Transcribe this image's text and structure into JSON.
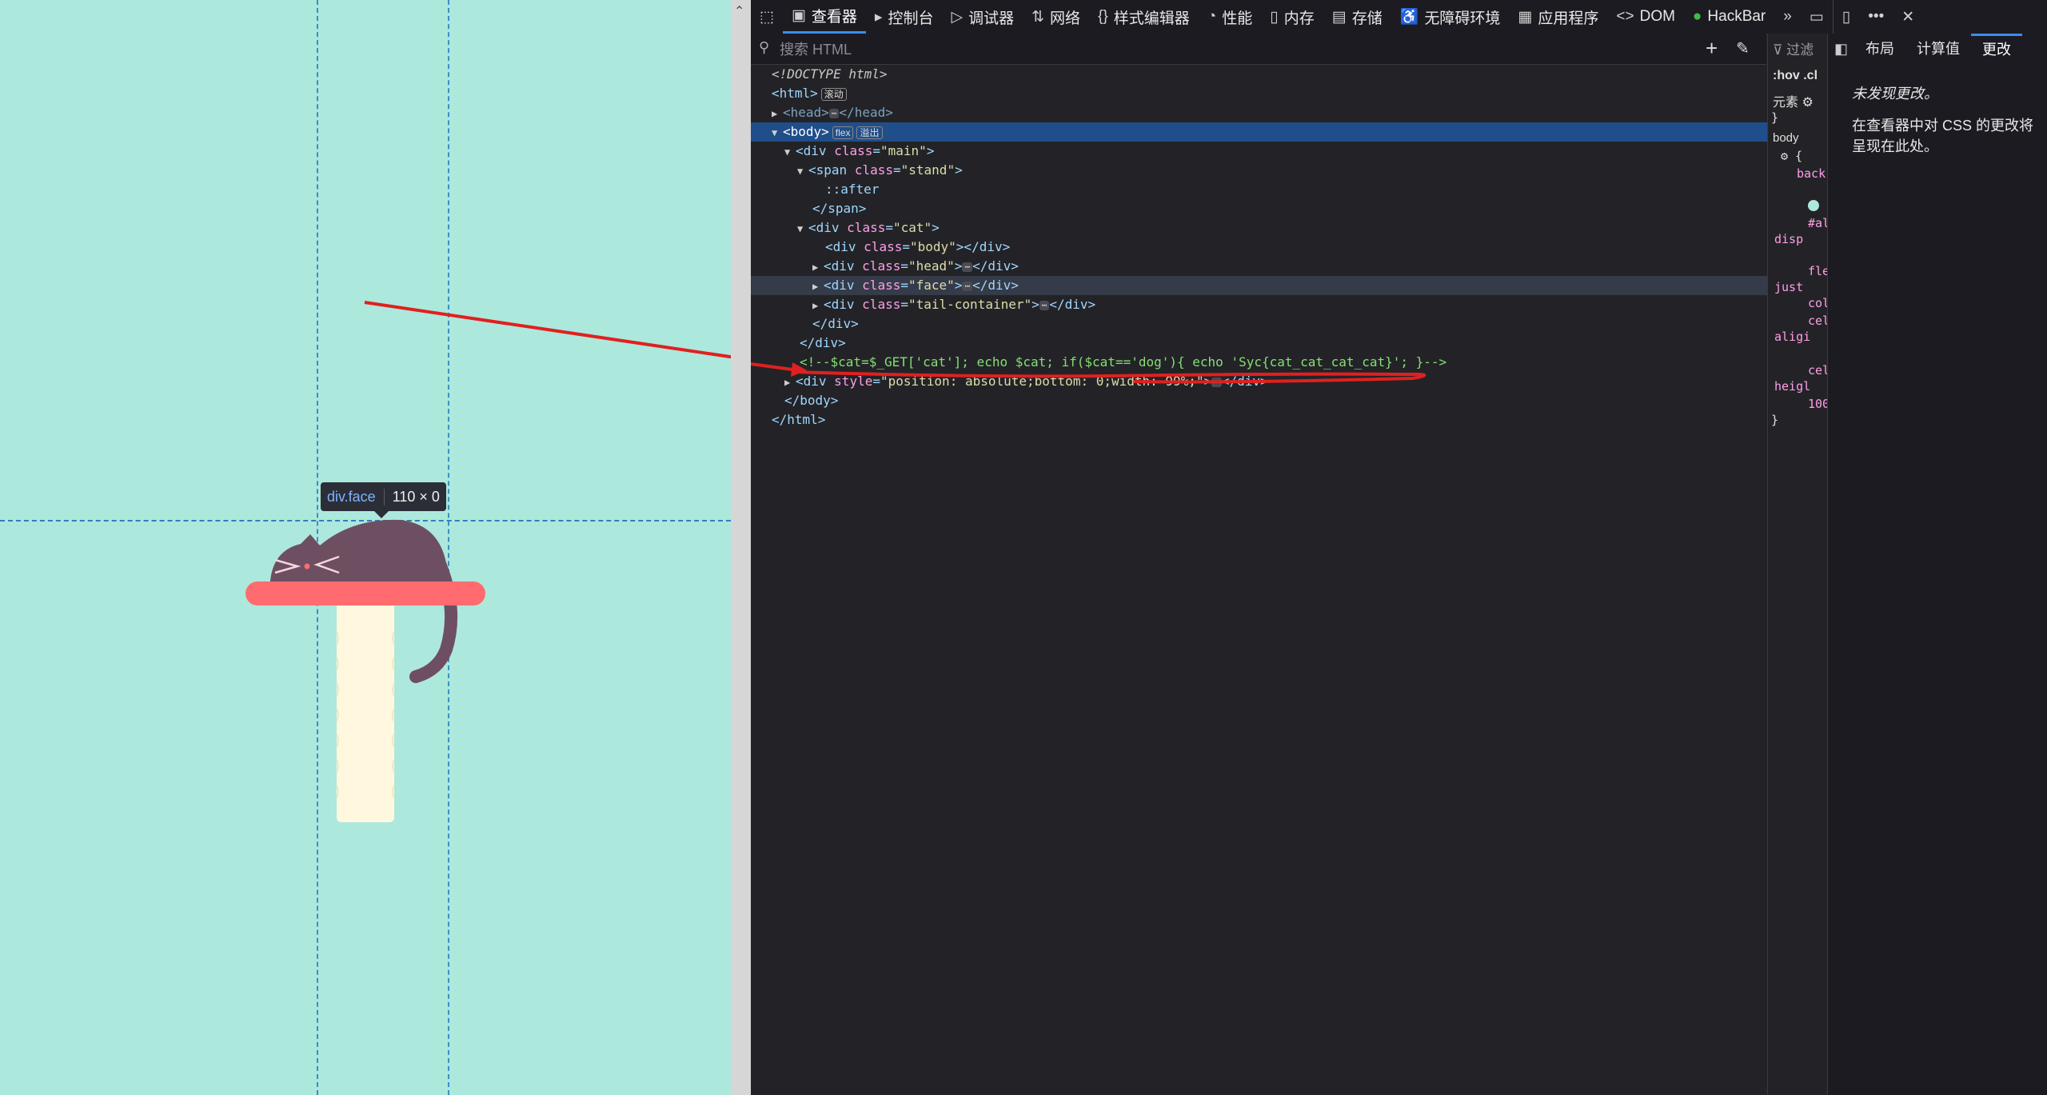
{
  "page_preview": {
    "background": "#ade8dc",
    "tooltip_selector": "div.face",
    "tooltip_size": "110 × 0",
    "cat_color": "#6e4f62",
    "stand_color": "#ff6b6e",
    "post_color": "#fff8df"
  },
  "toolbar": {
    "items": [
      {
        "label": "",
        "icon": "pick-element-icon"
      },
      {
        "label": "查看器",
        "icon": "inspector-icon"
      },
      {
        "label": "控制台",
        "icon": "console-icon"
      },
      {
        "label": "调试器",
        "icon": "debugger-icon"
      },
      {
        "label": "网络",
        "icon": "network-icon"
      },
      {
        "label": "样式编辑器",
        "icon": "style-editor-icon"
      },
      {
        "label": "性能",
        "icon": "performance-icon"
      },
      {
        "label": "内存",
        "icon": "memory-icon"
      },
      {
        "label": "存储",
        "icon": "storage-icon"
      },
      {
        "label": "无障碍环境",
        "icon": "accessibility-icon"
      },
      {
        "label": "应用程序",
        "icon": "application-icon"
      },
      {
        "label": "DOM",
        "icon": "dom-icon"
      },
      {
        "label": "HackBar",
        "icon": "hackbar-icon"
      }
    ]
  },
  "search": {
    "placeholder": "搜索 HTML"
  },
  "tree": {
    "doctype": "<!DOCTYPE html>",
    "html_open": "<html>",
    "badge_scroll": "滚动",
    "head": "<head>",
    "head_close": "</head>",
    "body_open": "<body>",
    "badge_flex": "flex",
    "badge_overflow": "溢出",
    "main_tag": "div",
    "main_class": "main",
    "span_tag": "span",
    "stand_class": "stand",
    "after": "::after",
    "span_close": "</span>",
    "cat_class": "cat",
    "body_class": "body",
    "head_class": "head",
    "face_class": "face",
    "tail_class": "tail-container",
    "div_close": "</div>",
    "comment": "<!--$cat=$_GET['cat']; echo $cat; if($cat=='dog'){ echo 'Syc{cat_cat_cat_cat}'; }-->",
    "last_div_style": "position: absolute;bottom: 0;width: 99%;",
    "body_close": "</body>",
    "html_close": "</html>"
  },
  "rules": {
    "tabs": [
      ":hov",
      ".cl"
    ],
    "filter": "过滤",
    "element": "元素",
    "selector": "body",
    "props": [
      "back",
      "#al",
      "disp",
      "fle",
      "just",
      "col",
      "cel",
      "aligi",
      "cel",
      "heigl",
      "100"
    ]
  },
  "changes": {
    "tabs": [
      "布局",
      "计算值",
      "更改"
    ],
    "empty_title": "未发现更改。",
    "empty_desc": "在查看器中对 CSS 的更改将呈现在此处。"
  }
}
